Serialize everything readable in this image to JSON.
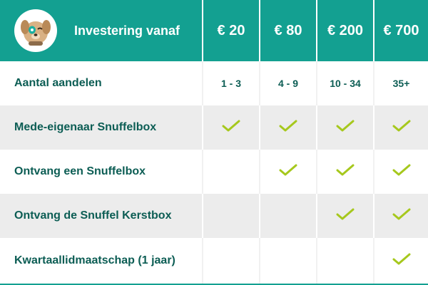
{
  "header": {
    "label": "Investering vanaf",
    "prices": [
      "€ 20",
      "€ 80",
      "€ 200",
      "€ 700"
    ]
  },
  "rows": [
    {
      "label": "Aantal aandelen",
      "values": [
        "1 - 3",
        "4 - 9",
        "10 - 34",
        "35+"
      ]
    },
    {
      "label": "Mede-eigenaar Snuffelbox",
      "checks": [
        true,
        true,
        true,
        true
      ]
    },
    {
      "label": "Ontvang een Snuffelbox",
      "checks": [
        false,
        true,
        true,
        true
      ]
    },
    {
      "label": "Ontvang de Snuffel Kerstbox",
      "checks": [
        false,
        false,
        true,
        true
      ]
    },
    {
      "label": "Kwartaallidmaatschap (1 jaar)",
      "checks": [
        false,
        false,
        false,
        true
      ]
    }
  ],
  "colors": {
    "header": "#13a091",
    "text": "#0c5d54",
    "check": "#a6c81d",
    "stripe": "#ececec"
  },
  "icons": {
    "mascot": "dog-mascot-icon",
    "check": "check-icon"
  }
}
